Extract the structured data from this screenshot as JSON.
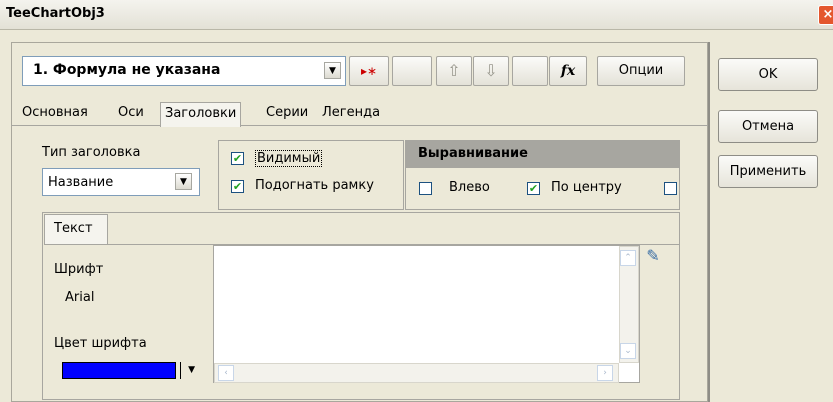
{
  "window": {
    "title": "TeeChartObj3",
    "close_glyph": "×"
  },
  "series_selector": {
    "value": "1.  Формула не указана",
    "dropdown_glyph": "▼"
  },
  "toolbar": {
    "add_glyph": "▸∗",
    "up_glyph": "⇧",
    "down_glyph": "⇩",
    "function_glyph": "fx",
    "options_label": "Опции"
  },
  "tabs": [
    "Основная",
    "Оси",
    "Заголовки",
    "Серии",
    "Легенда"
  ],
  "title_type": {
    "label": "Тип заголовка",
    "value": "Название",
    "dropdown_glyph": "▼"
  },
  "options": {
    "visible": {
      "label": "Видимый",
      "checked": true
    },
    "fit_frame": {
      "label": "Подогнать рамку",
      "checked": true
    }
  },
  "alignment": {
    "header": "Выравнивание",
    "left": {
      "label": "Влево",
      "checked": false
    },
    "center": {
      "label": "По центру",
      "checked": true
    }
  },
  "subtab": "Текст",
  "font": {
    "label": "Шрифт",
    "value": "Arial",
    "color_label": "Цвет шрифта",
    "color": "#0000ff"
  },
  "edit_icon": "✎",
  "buttons": {
    "ok": "OK",
    "cancel": "Отмена",
    "apply": "Применить"
  },
  "check_glyph": "✔",
  "scroll_glyphs": {
    "up": "⌃",
    "down": "⌄",
    "left": "‹",
    "right": "›"
  },
  "colors": {
    "header_bg": "#a7a6a0",
    "white": "#ffffff"
  }
}
